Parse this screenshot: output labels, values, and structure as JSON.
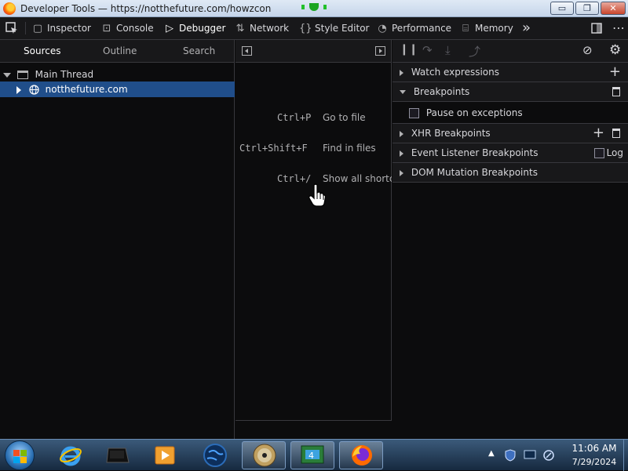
{
  "window": {
    "title": "Developer Tools — https://notthefuture.com/howzcon",
    "controls": {
      "minimize": "▭",
      "maximize": "❐",
      "close": "✕"
    }
  },
  "toolbar": {
    "tabs": [
      {
        "label": "Inspector",
        "icon": "inspector-icon"
      },
      {
        "label": "Console",
        "icon": "console-icon"
      },
      {
        "label": "Debugger",
        "icon": "debugger-icon",
        "active": true
      },
      {
        "label": "Network",
        "icon": "network-icon"
      },
      {
        "label": "Style Editor",
        "icon": "style-editor-icon"
      },
      {
        "label": "Performance",
        "icon": "performance-icon"
      },
      {
        "label": "Memory",
        "icon": "memory-icon"
      }
    ],
    "more": "»"
  },
  "sources_panel": {
    "tabs": [
      "Sources",
      "Outline",
      "Search"
    ],
    "tree": [
      {
        "label": "Main Thread",
        "icon": "window-icon",
        "expanded": true
      },
      {
        "label": "notthefuture.com",
        "icon": "globe-icon",
        "selected": true
      }
    ]
  },
  "editor": {
    "shortcuts": [
      {
        "key": "Ctrl+P",
        "label": "Go to file"
      },
      {
        "key": "Ctrl+Shift+F",
        "label": "Find in files"
      },
      {
        "key": "Ctrl+/",
        "label": "Show all shortc"
      }
    ]
  },
  "sidebar": {
    "sections": {
      "watch": "Watch expressions",
      "breakpoints": "Breakpoints",
      "pause_exceptions": "Pause on exceptions",
      "xhr": "XHR Breakpoints",
      "event_listener": "Event Listener Breakpoints",
      "log": "Log",
      "dom_mutation": "DOM Mutation Breakpoints"
    }
  },
  "taskbar": {
    "clock_time": "11:06 AM",
    "clock_date": "7/29/2024",
    "apps": [
      "internet-explorer-icon",
      "media-player-icon",
      "windows-media-center-icon",
      "globe-icon",
      "dvd-icon",
      "task-app-icon",
      "firefox-icon"
    ]
  },
  "colors": {
    "accent_selection": "#204e8a",
    "panel_bg": "#0c0c0d",
    "toolbar_bg": "#18181a"
  }
}
